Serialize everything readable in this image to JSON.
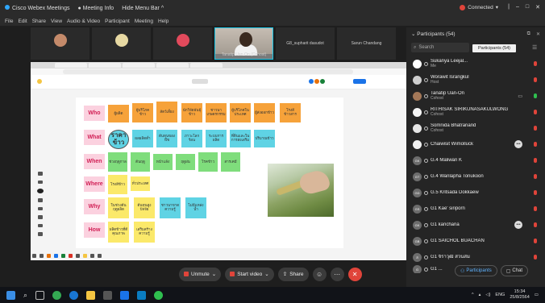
{
  "app": {
    "title": "Cisco Webex Meetings",
    "meeting_info": "Meeting Info",
    "hide_menu": "Hide Menu Bar",
    "connection": "Connected",
    "menu": [
      "File",
      "Edit",
      "Share",
      "View",
      "Audio & Video",
      "Participant",
      "Meeting",
      "Help"
    ]
  },
  "video_strip": [
    {
      "name": ""
    },
    {
      "name": ""
    },
    {
      "name": ""
    },
    {
      "name": "Tanatip Uan-On (Cohost)"
    },
    {
      "name": "G8_supharit dasudot"
    },
    {
      "name": "Sarun Chandang"
    }
  ],
  "whiteboard": {
    "rows": [
      "Who",
      "What",
      "When",
      "Where",
      "Why",
      "How"
    ],
    "who": [
      "ผู้ผลิต",
      "ผู้บริโภคข้าว",
      "สัตว์เลี้ยง",
      "นักวิจัยพันธุ์ข้าว",
      "ชาวนาเกษตรกรรม",
      "ผู้บริโภคในประเทศ",
      "ผู้ส่งออกข้าว",
      "โรงสีข้าวสาร"
    ],
    "what": [
      "ราคาข้าว",
      "ผลผลิตต่ำ",
      "ต้นทุนของพืช",
      "ภาวะโลกร้อน",
      "ระบบการผลิต",
      "ที่ดินและในการส่งเสริม",
      "ปริมาณข้าว"
    ],
    "when": [
      "ช่วงฤดูกาล",
      "ต้นฤดู",
      "หน้าแล้ง",
      "ฤดูฝน",
      "โรคข้าว",
      "สารเคมี"
    ],
    "where": [
      "โรงสีข้าว",
      "ทั่วประเทศ"
    ],
    "why": [
      "ในช่วงต้นฤดูผลิต",
      "ต้นทุนสูงปัจจัย",
      "ชาวนาขาดความรู้",
      "ไม่มีแหล่งน้ำ"
    ],
    "how": [
      "ผลิตข้าวที่ดีคุณภาพ",
      "เสริมสร้างความรู้"
    ]
  },
  "participants": {
    "header": "Participants (54)",
    "tooltip": "Participants (54)",
    "search_placeholder": "Search",
    "list": [
      {
        "name": "Sukanya Leejal...",
        "role": "Me",
        "mic": "red"
      },
      {
        "name": "Worawit Israngkul",
        "role": "Host",
        "mic": "red"
      },
      {
        "name": "Tanatip Uan-On",
        "role": "Cohost",
        "mic": "green"
      },
      {
        "name": "RITHISAK SIRIKUNASAKULWONG",
        "role": "Cohost",
        "mic": "red"
      },
      {
        "name": "Somnida Bhatranand",
        "role": "Cohost",
        "mic": "red"
      },
      {
        "name": "Chaiwisit Wimolluck",
        "role": "",
        "mic": "red"
      },
      {
        "name": "G.4 Maliwan K",
        "role": "",
        "mic": "red"
      },
      {
        "name": "G.4 Wanlapha Tonukoon",
        "role": "",
        "mic": "red"
      },
      {
        "name": "G.5 Kritsada Dokkaew",
        "role": "",
        "mic": "red"
      },
      {
        "name": "G1 Kae' siriporn",
        "role": "",
        "mic": "red"
      },
      {
        "name": "G1 kanchana",
        "role": "",
        "mic": "red"
      },
      {
        "name": "G1 SAICHOL BUACHAN",
        "role": "",
        "mic": "red"
      },
      {
        "name": "G1 จิราวุฒิ สวนสม",
        "role": "",
        "mic": "red"
      },
      {
        "name": "G1 ...",
        "role": "",
        "mic": "red"
      }
    ],
    "buttons": {
      "participants": "Participants",
      "chat": "Chat"
    }
  },
  "controls": {
    "unmute": "Unmute",
    "start_video": "Start video",
    "share": "Share"
  },
  "taskbar": {
    "lang": "ENG",
    "time": "15:34",
    "date": "25/8/2564"
  },
  "colors": {
    "accent": "#19c6e6",
    "end": "#e0443a",
    "mic_on": "#2fbf4f"
  }
}
